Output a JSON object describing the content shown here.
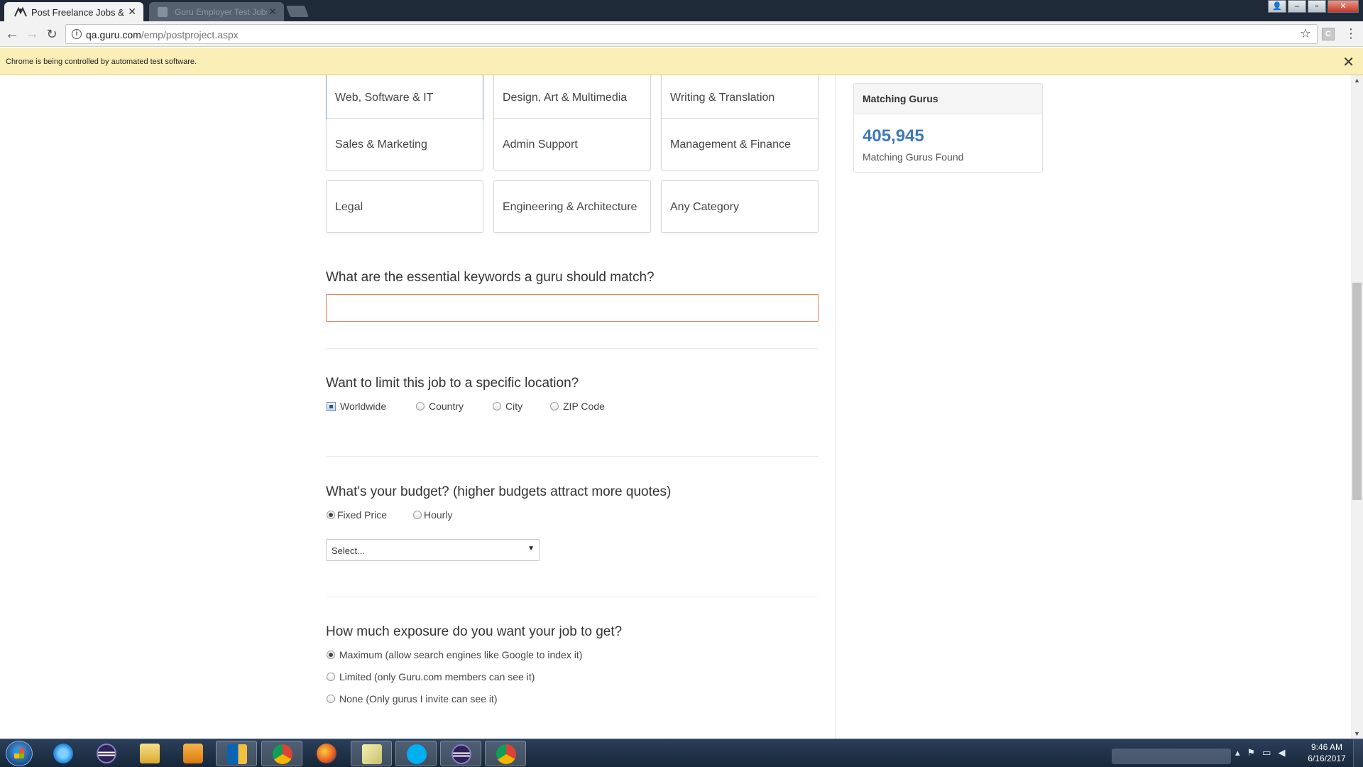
{
  "browser": {
    "tabs": [
      {
        "title": "Post Freelance Jobs & Pr",
        "active": true
      },
      {
        "title": "Guru Employer Test Jobs",
        "active": false
      }
    ],
    "url_host": "qa.guru.com",
    "url_path": "/emp/postproject.aspx",
    "infobar_message": "Chrome is being controlled by automated test software."
  },
  "categories": [
    {
      "label": "Web, Software & IT",
      "selected": true
    },
    {
      "label": "Design, Art & Multimedia",
      "selected": false
    },
    {
      "label": "Writing & Translation",
      "selected": false
    },
    {
      "label": "Sales & Marketing",
      "selected": false
    },
    {
      "label": "Admin Support",
      "selected": false
    },
    {
      "label": "Management & Finance",
      "selected": false
    },
    {
      "label": "Legal",
      "selected": false
    },
    {
      "label": "Engineering & Architecture",
      "selected": false
    },
    {
      "label": "Any Category",
      "selected": false
    }
  ],
  "keywords": {
    "question": "What are the essential keywords a guru should match?",
    "value": ""
  },
  "location": {
    "question": "Want to limit this job to a specific location?",
    "options": [
      "Worldwide",
      "Country",
      "City",
      "ZIP Code"
    ],
    "selected": "Worldwide"
  },
  "budget": {
    "question": "What's your budget? (higher budgets attract more quotes)",
    "options": [
      "Fixed Price",
      "Hourly"
    ],
    "selected": "Fixed Price",
    "select_value": "Select..."
  },
  "exposure": {
    "question": "How much exposure do you want your job to get?",
    "options": [
      "Maximum (allow search engines like Google to index it)",
      "Limited (only Guru.com members can see it)",
      "None (Only gurus I invite can see it)"
    ],
    "selected": "Maximum (allow search engines like Google to index it)"
  },
  "sidebar": {
    "title": "Matching Gurus",
    "count": "405,945",
    "subtitle": "Matching Gurus Found"
  },
  "taskbar": {
    "clock_time": "9:46 AM",
    "clock_date": "6/16/2017"
  }
}
